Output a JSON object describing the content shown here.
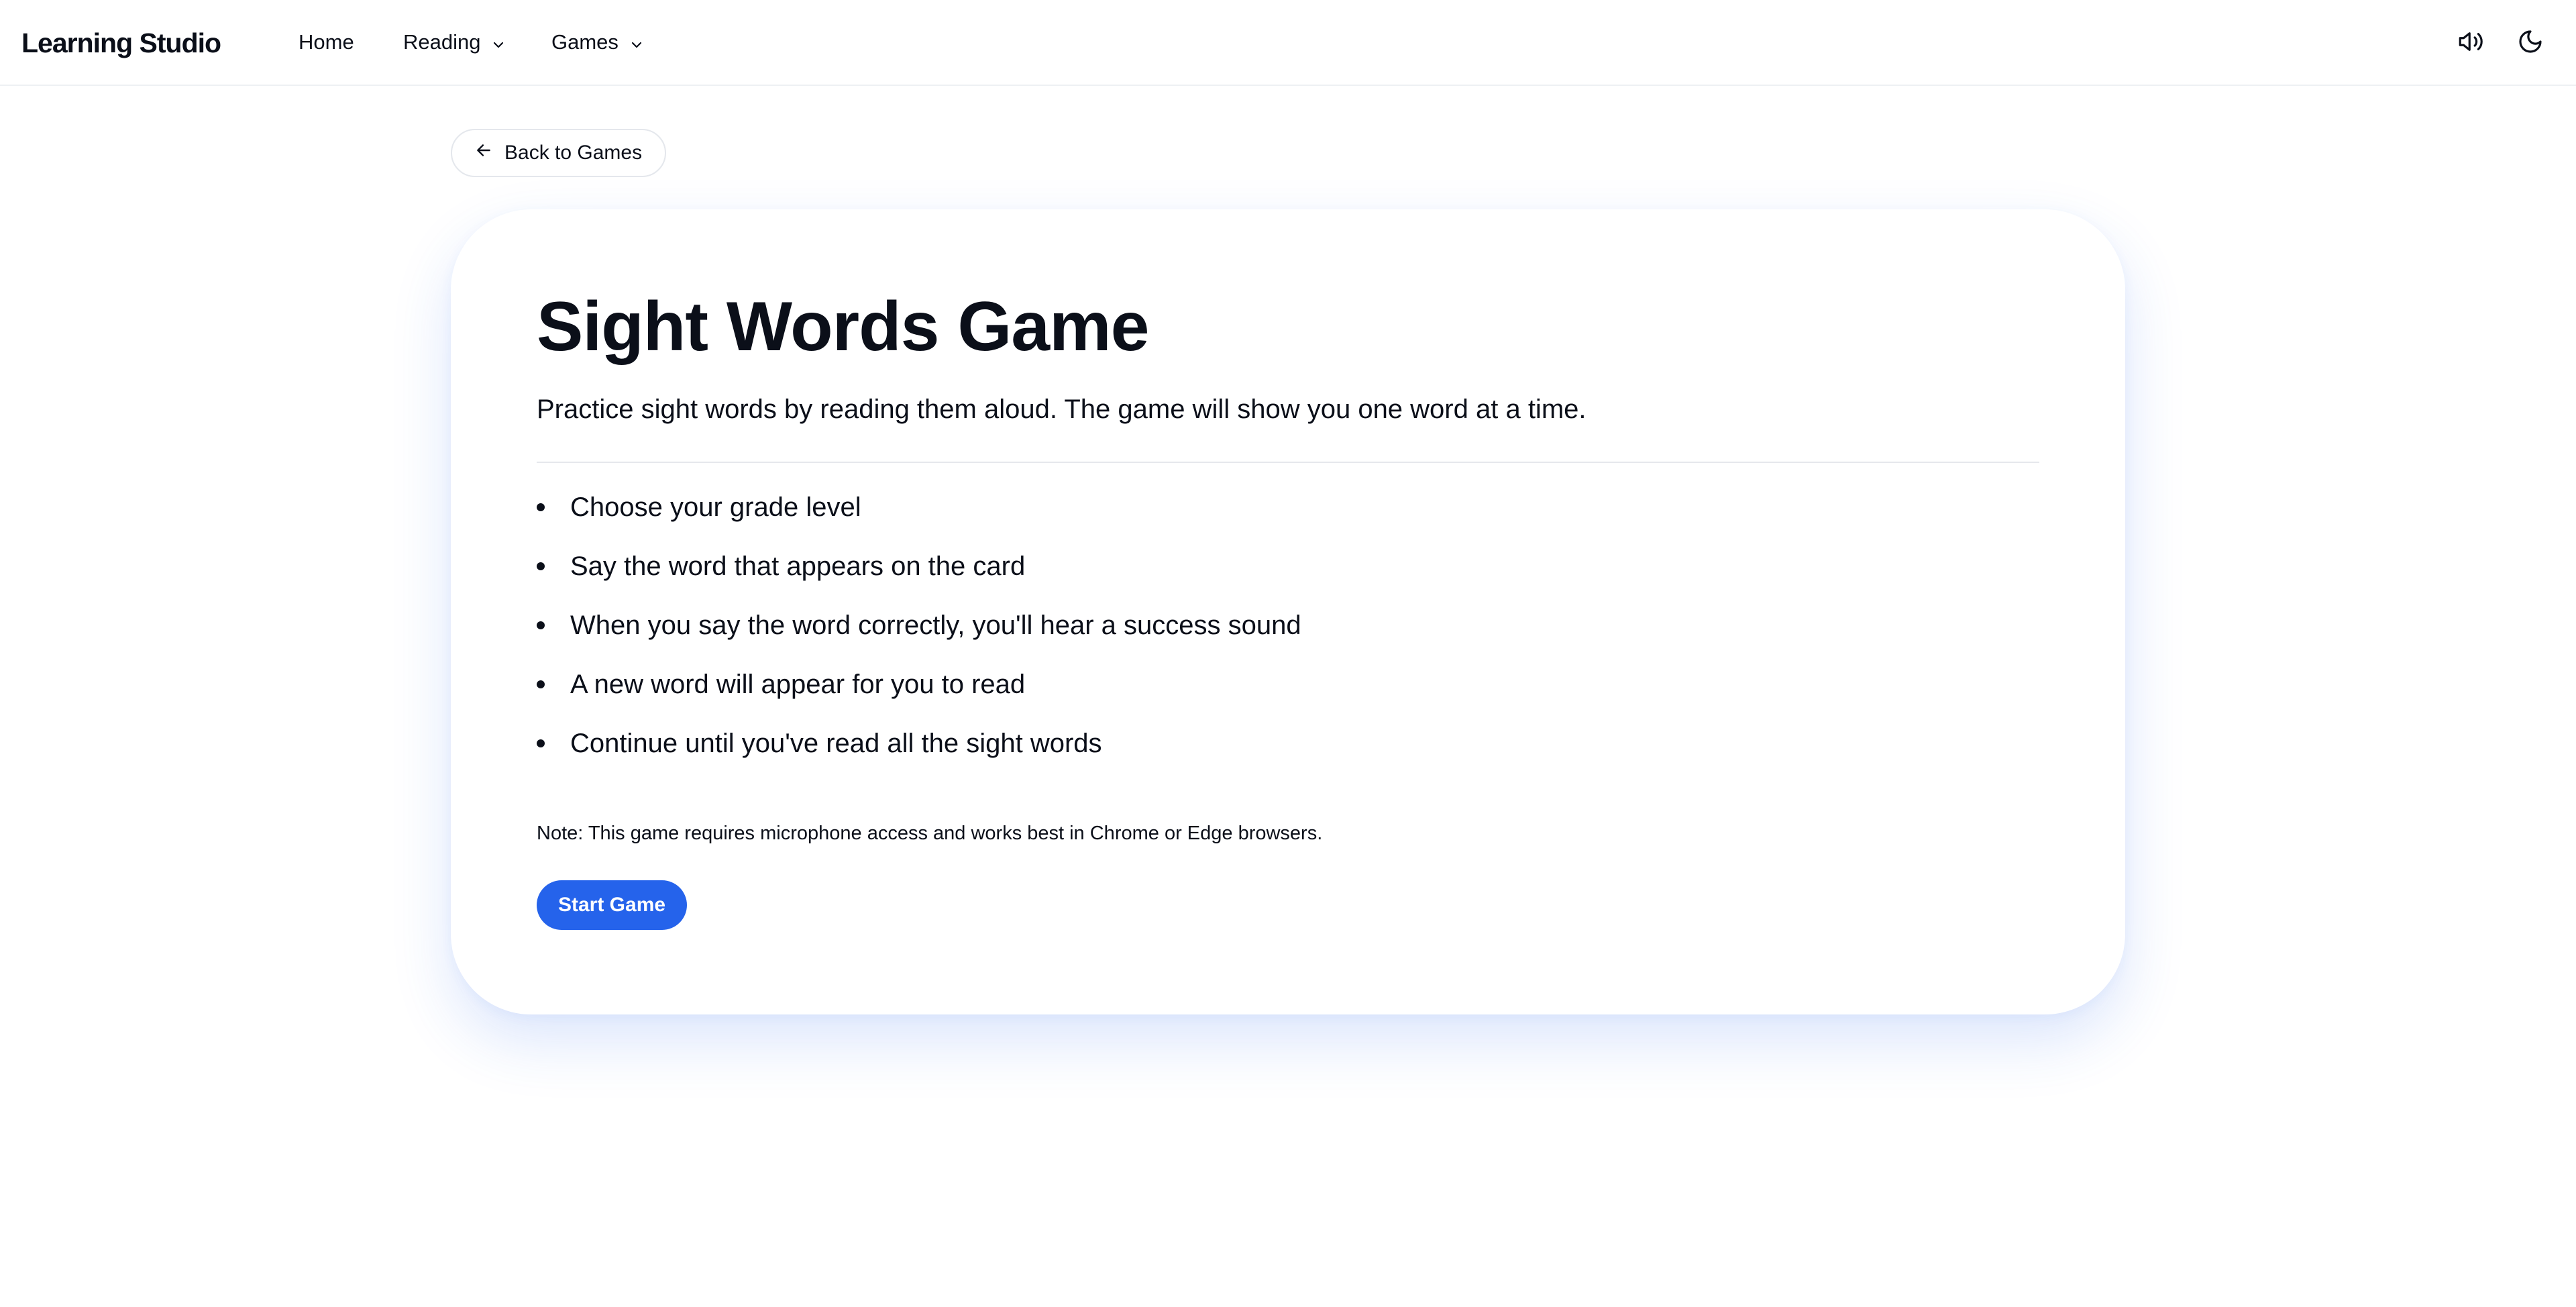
{
  "header": {
    "brand": "Learning Studio",
    "nav": {
      "home": "Home",
      "reading": "Reading",
      "games": "Games"
    },
    "icons": {
      "sound": "speaker-icon",
      "theme": "moon-icon"
    }
  },
  "back_button": {
    "label": "Back to Games",
    "icon": "arrow-left-icon"
  },
  "game": {
    "title": "Sight Words Game",
    "description": "Practice sight words by reading them aloud. The game will show you one word at a time.",
    "steps": [
      "Choose your grade level",
      "Say the word that appears on the card",
      "When you say the word correctly, you'll hear a success sound",
      "A new word will appear for you to read",
      "Continue until you've read all the sight words"
    ],
    "note": "Note: This game requires microphone access and works best in Chrome or Edge browsers.",
    "start_label": "Start Game"
  },
  "colors": {
    "accent": "#2563eb",
    "text": "#0b0f19",
    "background": "#ffffff"
  }
}
